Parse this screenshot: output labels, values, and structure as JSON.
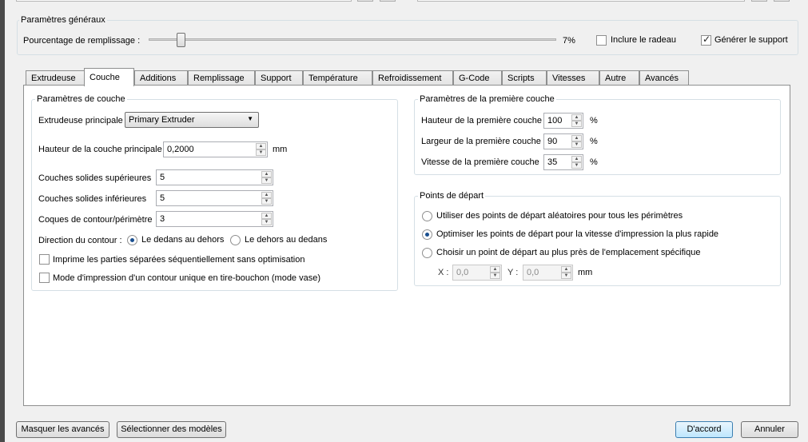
{
  "general": {
    "title": "Paramètres généraux",
    "fill_label": "Pourcentage de remplissage :",
    "fill_value": "7%",
    "fill_fraction": 0.07,
    "raft_label": "Inclure le radeau",
    "raft_checked": false,
    "support_label": "Générer le support",
    "support_checked": true
  },
  "tabs": [
    {
      "label": "Extrudeuse"
    },
    {
      "label": "Couche",
      "active": true
    },
    {
      "label": "Additions"
    },
    {
      "label": "Remplissage"
    },
    {
      "label": "Support"
    },
    {
      "label": "Température"
    },
    {
      "label": "Refroidissement"
    },
    {
      "label": "G-Code"
    },
    {
      "label": "Scripts"
    },
    {
      "label": "Vitesses"
    },
    {
      "label": "Autre"
    },
    {
      "label": "Avancés"
    }
  ],
  "layer": {
    "title": "Paramètres de couche",
    "main_extruder_label": "Extrudeuse principale",
    "main_extruder_value": "Primary Extruder",
    "main_height_label": "Hauteur de la couche principale",
    "main_height_value": "0,2000",
    "main_height_unit": "mm",
    "top_solid_label": "Couches solides supérieures",
    "top_solid_value": "5",
    "bottom_solid_label": "Couches solides inférieures",
    "bottom_solid_value": "5",
    "shells_label": "Coques de contour/périmètre",
    "shells_value": "3",
    "direction_label": "Direction du contour :",
    "dir_inside_out": "Le dedans au dehors",
    "dir_outside_in": "Le dehors au dedans",
    "sequential_label": "Imprime les parties séparées séquentiellement sans optimisation",
    "vase_label": "Mode d'impression d'un contour unique en tire-bouchon (mode vase)"
  },
  "first_layer": {
    "title": "Paramètres de la première couche",
    "height_label": "Hauteur de la première couche",
    "height_value": "100",
    "width_label": "Largeur de la première couche",
    "width_value": "90",
    "speed_label": "Vitesse de la première couche",
    "speed_value": "35",
    "unit": "%"
  },
  "start_points": {
    "title": "Points de départ",
    "random_label": "Utiliser des points de départ aléatoires pour tous les périmètres",
    "optimize_label": "Optimiser les points de départ pour la vitesse d'impression la plus rapide",
    "specific_label": "Choisir un point de départ au plus près de l'emplacement spécifique",
    "x_label": "X :",
    "x_value": "0,0",
    "y_label": "Y :",
    "y_value": "0,0",
    "unit": "mm"
  },
  "footer": {
    "hide_advanced": "Masquer les avancés",
    "select_models": "Sélectionner des modèles",
    "ok": "D'accord",
    "cancel": "Annuler"
  },
  "colors": {
    "window_bg": "#f0f0f0",
    "radio_dot": "#1a4f8f"
  }
}
